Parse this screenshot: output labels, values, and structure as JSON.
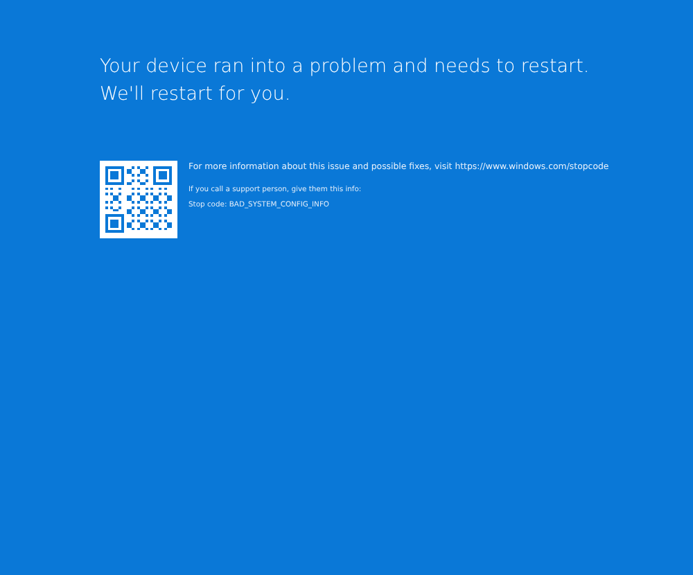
{
  "message": "Your device ran into a problem and needs to restart. We'll restart for you.",
  "info": "For more information about this issue and possible fixes, visit https://www.windows.com/stopcode",
  "support": "If you call a support person, give them this info:",
  "stop_code": "Stop code: BAD_SYSTEM_CONFIG_INFO"
}
